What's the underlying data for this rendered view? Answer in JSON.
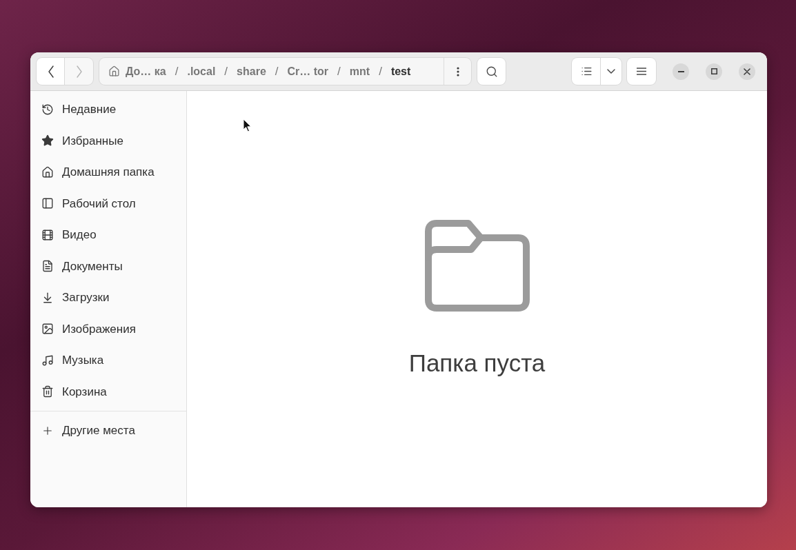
{
  "header": {
    "nav_buttons": [
      {
        "kind": "back",
        "disabled": false
      },
      {
        "kind": "forward",
        "disabled": true
      }
    ],
    "path": {
      "items": [
        {
          "kind": "home",
          "label": "До… ка",
          "selected": false
        },
        {
          "kind": "separator",
          "label": "/"
        },
        {
          "kind": "folder",
          "label": ".local",
          "selected": false
        },
        {
          "kind": "separator",
          "label": "/"
        },
        {
          "kind": "folder",
          "label": "share",
          "selected": false
        },
        {
          "kind": "separator",
          "label": "/"
        },
        {
          "kind": "folder",
          "label": "Cr… tor",
          "selected": false
        },
        {
          "kind": "separator",
          "label": "/"
        },
        {
          "kind": "folder",
          "label": "mnt",
          "selected": false
        },
        {
          "kind": "separator",
          "label": "/"
        },
        {
          "kind": "folder",
          "label": "test",
          "selected": true
        }
      ]
    }
  },
  "sidebar": {
    "items": [
      {
        "kind": "recent",
        "label": "Недавние",
        "selected": false
      },
      {
        "kind": "starred",
        "label": "Избранные",
        "selected": false
      },
      {
        "kind": "home",
        "label": "Домашняя папка",
        "selected": false
      },
      {
        "kind": "desktop",
        "label": "Рабочий стол",
        "selected": false
      },
      {
        "kind": "videos",
        "label": "Видео",
        "selected": false
      },
      {
        "kind": "documents",
        "label": "Документы",
        "selected": false
      },
      {
        "kind": "downloads",
        "label": "Загрузки",
        "selected": false
      },
      {
        "kind": "pictures",
        "label": "Изображения",
        "selected": false
      },
      {
        "kind": "music",
        "label": "Музыка",
        "selected": false
      },
      {
        "kind": "trash",
        "label": "Корзина",
        "selected": false
      }
    ],
    "other_places": {
      "label": "Другие места"
    }
  },
  "content": {
    "empty_message": "Папка пуста"
  }
}
